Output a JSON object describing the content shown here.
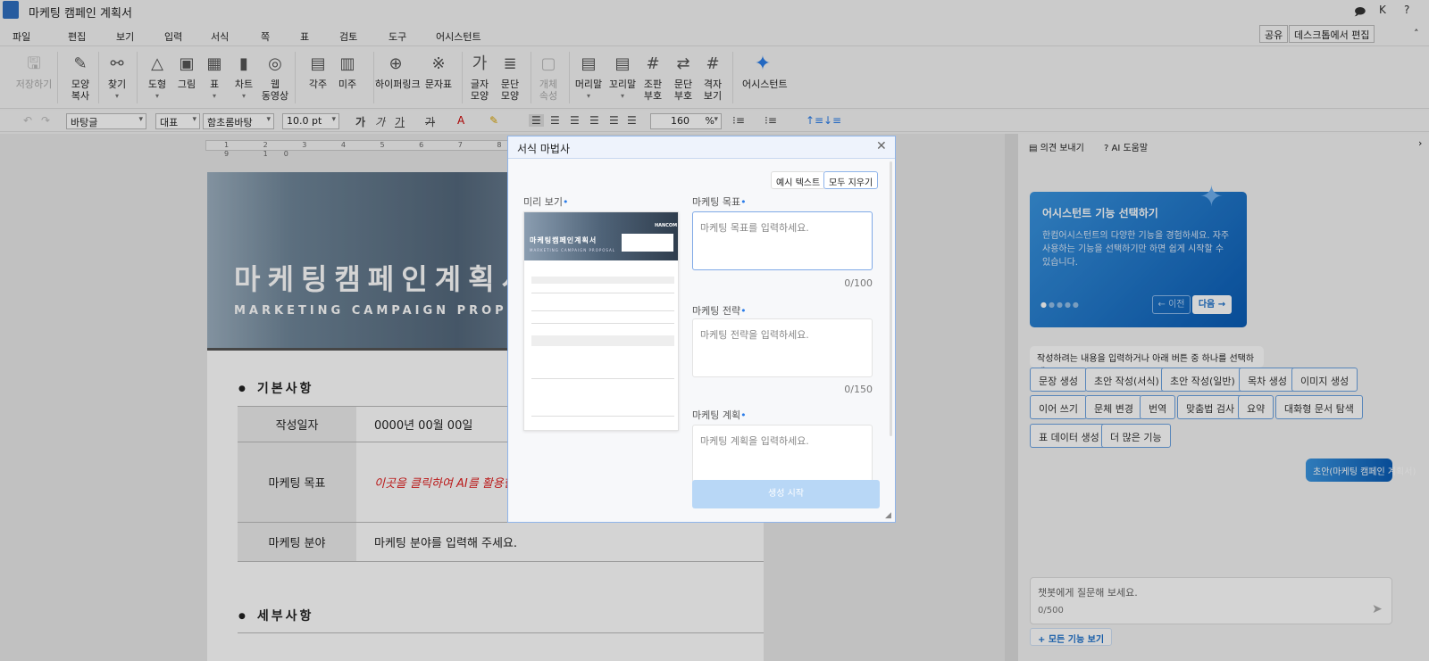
{
  "window": {
    "title": "마케팅 캠페인 계획서",
    "user_initial": "K",
    "help": "?"
  },
  "menu": [
    "파일",
    "편집",
    "보기",
    "입력",
    "서식",
    "쪽",
    "표",
    "검토",
    "도구",
    "어시스턴트"
  ],
  "top_buttons": {
    "share": "공유",
    "edit_desktop": "데스크톱에서 편집"
  },
  "ribbon": [
    {
      "label": "저장하기",
      "icon": "save-icon",
      "disabled": true
    },
    {
      "label": "모양\n복사",
      "icon": "format-painter-icon"
    },
    {
      "label": "찾기",
      "icon": "binoculars-icon",
      "dropdown": true
    },
    {
      "label": "도형",
      "icon": "shape-icon",
      "dropdown": true
    },
    {
      "label": "그림",
      "icon": "picture-icon"
    },
    {
      "label": "표",
      "icon": "table-icon",
      "dropdown": true
    },
    {
      "label": "차트",
      "icon": "chart-icon",
      "dropdown": true
    },
    {
      "label": "웹\n동영상",
      "icon": "web-video-icon"
    },
    {
      "label": "각주",
      "icon": "footnote-icon"
    },
    {
      "label": "미주",
      "icon": "endnote-icon"
    },
    {
      "label": "하이퍼링크",
      "icon": "hyperlink-icon"
    },
    {
      "label": "문자표",
      "icon": "symbol-icon"
    },
    {
      "label": "글자\n모양",
      "icon": "char-shape-icon"
    },
    {
      "label": "문단\n모양",
      "icon": "para-shape-icon"
    },
    {
      "label": "개체\n속성",
      "icon": "object-props-icon",
      "disabled": true
    },
    {
      "label": "머리말",
      "icon": "header-icon",
      "dropdown": true
    },
    {
      "label": "꼬리말",
      "icon": "footer-icon",
      "dropdown": true
    },
    {
      "label": "조판\n부호",
      "icon": "control-code-icon"
    },
    {
      "label": "문단\n부호",
      "icon": "para-mark-icon"
    },
    {
      "label": "격자\n보기",
      "icon": "grid-icon"
    },
    {
      "label": "어시스턴트",
      "icon": "sparkle-icon"
    }
  ],
  "format_bar": {
    "style": "바탕글",
    "lang": "대표",
    "font": "함초롬바탕",
    "size": "10.0",
    "size_unit": "pt",
    "line_spacing": "160",
    "line_unit": "%",
    "char_buttons": [
      "가",
      "가",
      "가",
      "가"
    ]
  },
  "ruler": "1 2 3 4 5 6 7 8 9 10",
  "document": {
    "banner_title": "마케팅캠페인계획서",
    "banner_subtitle": "MARKETING CAMPAIGN PROPOSAL",
    "section1": "기본사항",
    "rows": [
      {
        "h": "작성일자",
        "v": "0000년 00월 00일"
      },
      {
        "h": "마케팅 목표",
        "v": "이곳을 클릭하여 AI를 활용한",
        "red": true
      },
      {
        "h": "마케팅 분야",
        "v": "마케팅 분야를 입력해 주세요."
      }
    ],
    "section2": "세부사항"
  },
  "modal": {
    "title": "서식 마법사",
    "sample_text": "예시 텍스트",
    "clear_all": "모두 지우기",
    "preview_label": "미리 보기",
    "preview": {
      "title": "마케팅캠페인계획서",
      "subtitle": "MARKETING CAMPAIGN PROPOSAL",
      "logo": "HANCOM"
    },
    "fields": [
      {
        "label": "마케팅 목표",
        "placeholder": "마케팅 목표를 입력하세요.",
        "count": "0/100"
      },
      {
        "label": "마케팅 전략",
        "placeholder": "마케팅 전략을 입력하세요.",
        "count": "0/150"
      },
      {
        "label": "마케팅 계획",
        "placeholder": "마케팅 계획을 입력하세요."
      }
    ],
    "generate": "생성 시작"
  },
  "assistant": {
    "feedback": "의견 보내기",
    "help": "AI 도움말",
    "card_title": "어시스턴트 기능 선택하기",
    "card_body": "한컴어시스턴트의 다양한 기능을 경험하세요. 자주 사용하는 기능을 선택하기만 하면 쉽게 시작할 수 있습니다.",
    "prev": "← 이전",
    "next": "다음 →",
    "slide": 1,
    "slides": 5,
    "prompt": "작성하려는 내용을 입력하거나 아래 버튼 중 하나를 선택하세요.",
    "chips": [
      "문장 생성",
      "초안 작성(서식)",
      "초안 작성(일반)",
      "목차 생성",
      "이미지 생성",
      "이어 쓰기",
      "문체 변경",
      "번역",
      "맞춤법 검사",
      "요약",
      "대화형 문서 탐색",
      "표 데이터 생성",
      "더 많은 기능"
    ],
    "user_msg": "초안(마케팅 캠페인 계획서)",
    "chat_placeholder": "챗봇에게 질문해 보세요.",
    "chat_count": "0/500",
    "all_features": "+ 모든 기능 보기"
  },
  "colors": {
    "accent": "#2b7de9",
    "card": "#1a6fcb",
    "red_text": "#e02020"
  }
}
